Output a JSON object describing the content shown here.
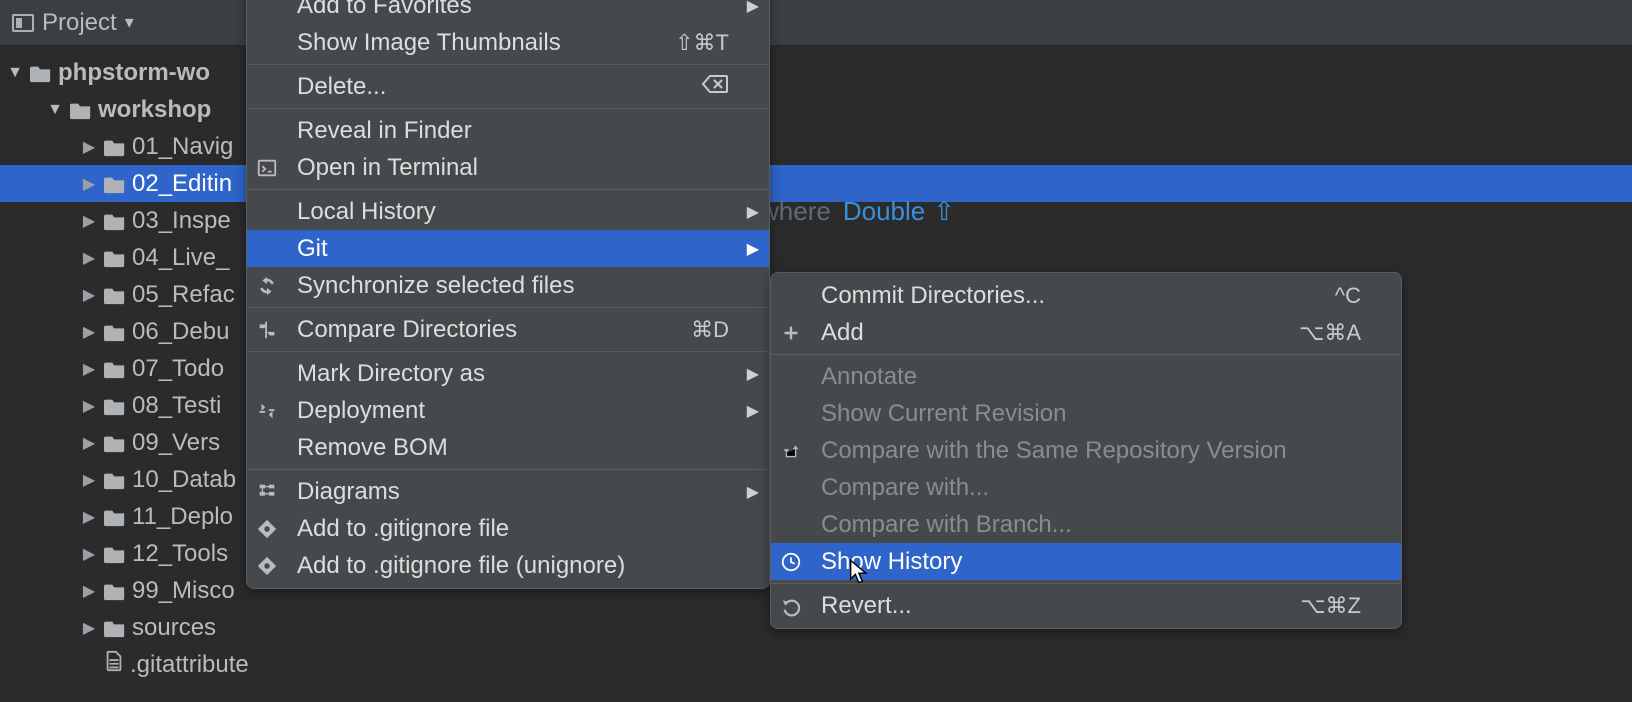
{
  "toolwindow": {
    "title": "Project"
  },
  "tree": {
    "root": {
      "label": "phpstorm-wo",
      "expanded": true
    },
    "workshop": {
      "label": "workshop",
      "expanded": true
    },
    "items": [
      {
        "label": "01_Navig"
      },
      {
        "label": "02_Editin"
      },
      {
        "label": "03_Inspe"
      },
      {
        "label": "04_Live_"
      },
      {
        "label": "05_Refac"
      },
      {
        "label": "06_Debu"
      },
      {
        "label": "07_Todo"
      },
      {
        "label": "08_Testi"
      },
      {
        "label": "09_Vers"
      },
      {
        "label": "10_Datab"
      },
      {
        "label": "11_Deplo"
      },
      {
        "label": "12_Tools"
      },
      {
        "label": "99_Misco"
      }
    ],
    "sources": {
      "label": "sources"
    },
    "gitattr": {
      "label": ".gitattribute"
    }
  },
  "hint": {
    "tail": "where",
    "kbd": "Double",
    "sym": "⇧"
  },
  "menu1": {
    "favorites": "Add to Favorites",
    "thumbnails": {
      "label": "Show Image Thumbnails",
      "shortcut": "⇧⌘T"
    },
    "delete": {
      "label": "Delete...",
      "shortcut": "⌦"
    },
    "reveal": "Reveal in Finder",
    "open_terminal": "Open in Terminal",
    "local_history": "Local History",
    "git": "Git",
    "sync": "Synchronize selected files",
    "compare": {
      "label": "Compare Directories",
      "shortcut": "⌘D"
    },
    "mark_dir": "Mark Directory as",
    "deployment": "Deployment",
    "remove_bom": "Remove BOM",
    "diagrams": "Diagrams",
    "gitignore1": "Add to .gitignore file",
    "gitignore2": "Add to .gitignore file (unignore)"
  },
  "menu2": {
    "commit": {
      "label": "Commit Directories...",
      "shortcut": "^C"
    },
    "add": {
      "label": "Add",
      "shortcut": "⌥⌘A"
    },
    "annotate": "Annotate",
    "show_rev": "Show Current Revision",
    "cmp_same": "Compare with the Same Repository Version",
    "cmp_with": "Compare with...",
    "cmp_branch": "Compare with Branch...",
    "show_history": "Show History",
    "revert": {
      "label": "Revert...",
      "shortcut": "⌥⌘Z"
    }
  }
}
